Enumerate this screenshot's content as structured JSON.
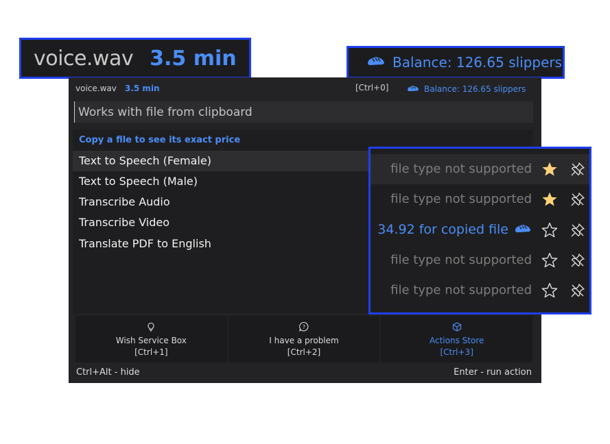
{
  "callouts": {
    "file_name": "voice.wav",
    "duration": "3.5 min",
    "balance": "Balance: 126.65 slippers"
  },
  "header": {
    "file_name": "voice.wav",
    "duration": "3.5 min",
    "shortcut": "[Ctrl+0]",
    "balance": "Balance: 126.65 slippers",
    "balance_icon": "slipper-icon"
  },
  "search": {
    "placeholder": "Works with file from clipboard",
    "value": ""
  },
  "list": {
    "hint": "Copy a file to see its exact price",
    "items": [
      {
        "label": "Text to Speech (Female)",
        "status": "file type not supported",
        "favorite": true,
        "selected": true
      },
      {
        "label": "Text to Speech (Male)",
        "status": "file type not supported",
        "favorite": true,
        "selected": false
      },
      {
        "label": "Transcribe Audio",
        "status": "34.92 for copied file",
        "favorite": false,
        "selected": false
      },
      {
        "label": "Transcribe Video",
        "status": "file type not supported",
        "favorite": false,
        "selected": false
      },
      {
        "label": "Translate PDF to English",
        "status": "file type not supported",
        "favorite": false,
        "selected": false
      }
    ]
  },
  "bottom": {
    "wish": {
      "icon": "lightbulb-icon",
      "label": "Wish Service Box",
      "shortcut": "[Ctrl+1]"
    },
    "problem": {
      "icon": "question-bubble-icon",
      "label": "I have a problem",
      "shortcut": "[Ctrl+2]"
    },
    "store": {
      "icon": "cube-icon",
      "label": "Actions Store",
      "shortcut": "[Ctrl+3]"
    }
  },
  "footer": {
    "left": "Ctrl+Alt - hide",
    "right": "Enter - run action"
  },
  "colors": {
    "accent": "#4b8df8",
    "callout_border": "#1e3ff0",
    "star_filled": "#ffd27a",
    "background": "#232325"
  }
}
